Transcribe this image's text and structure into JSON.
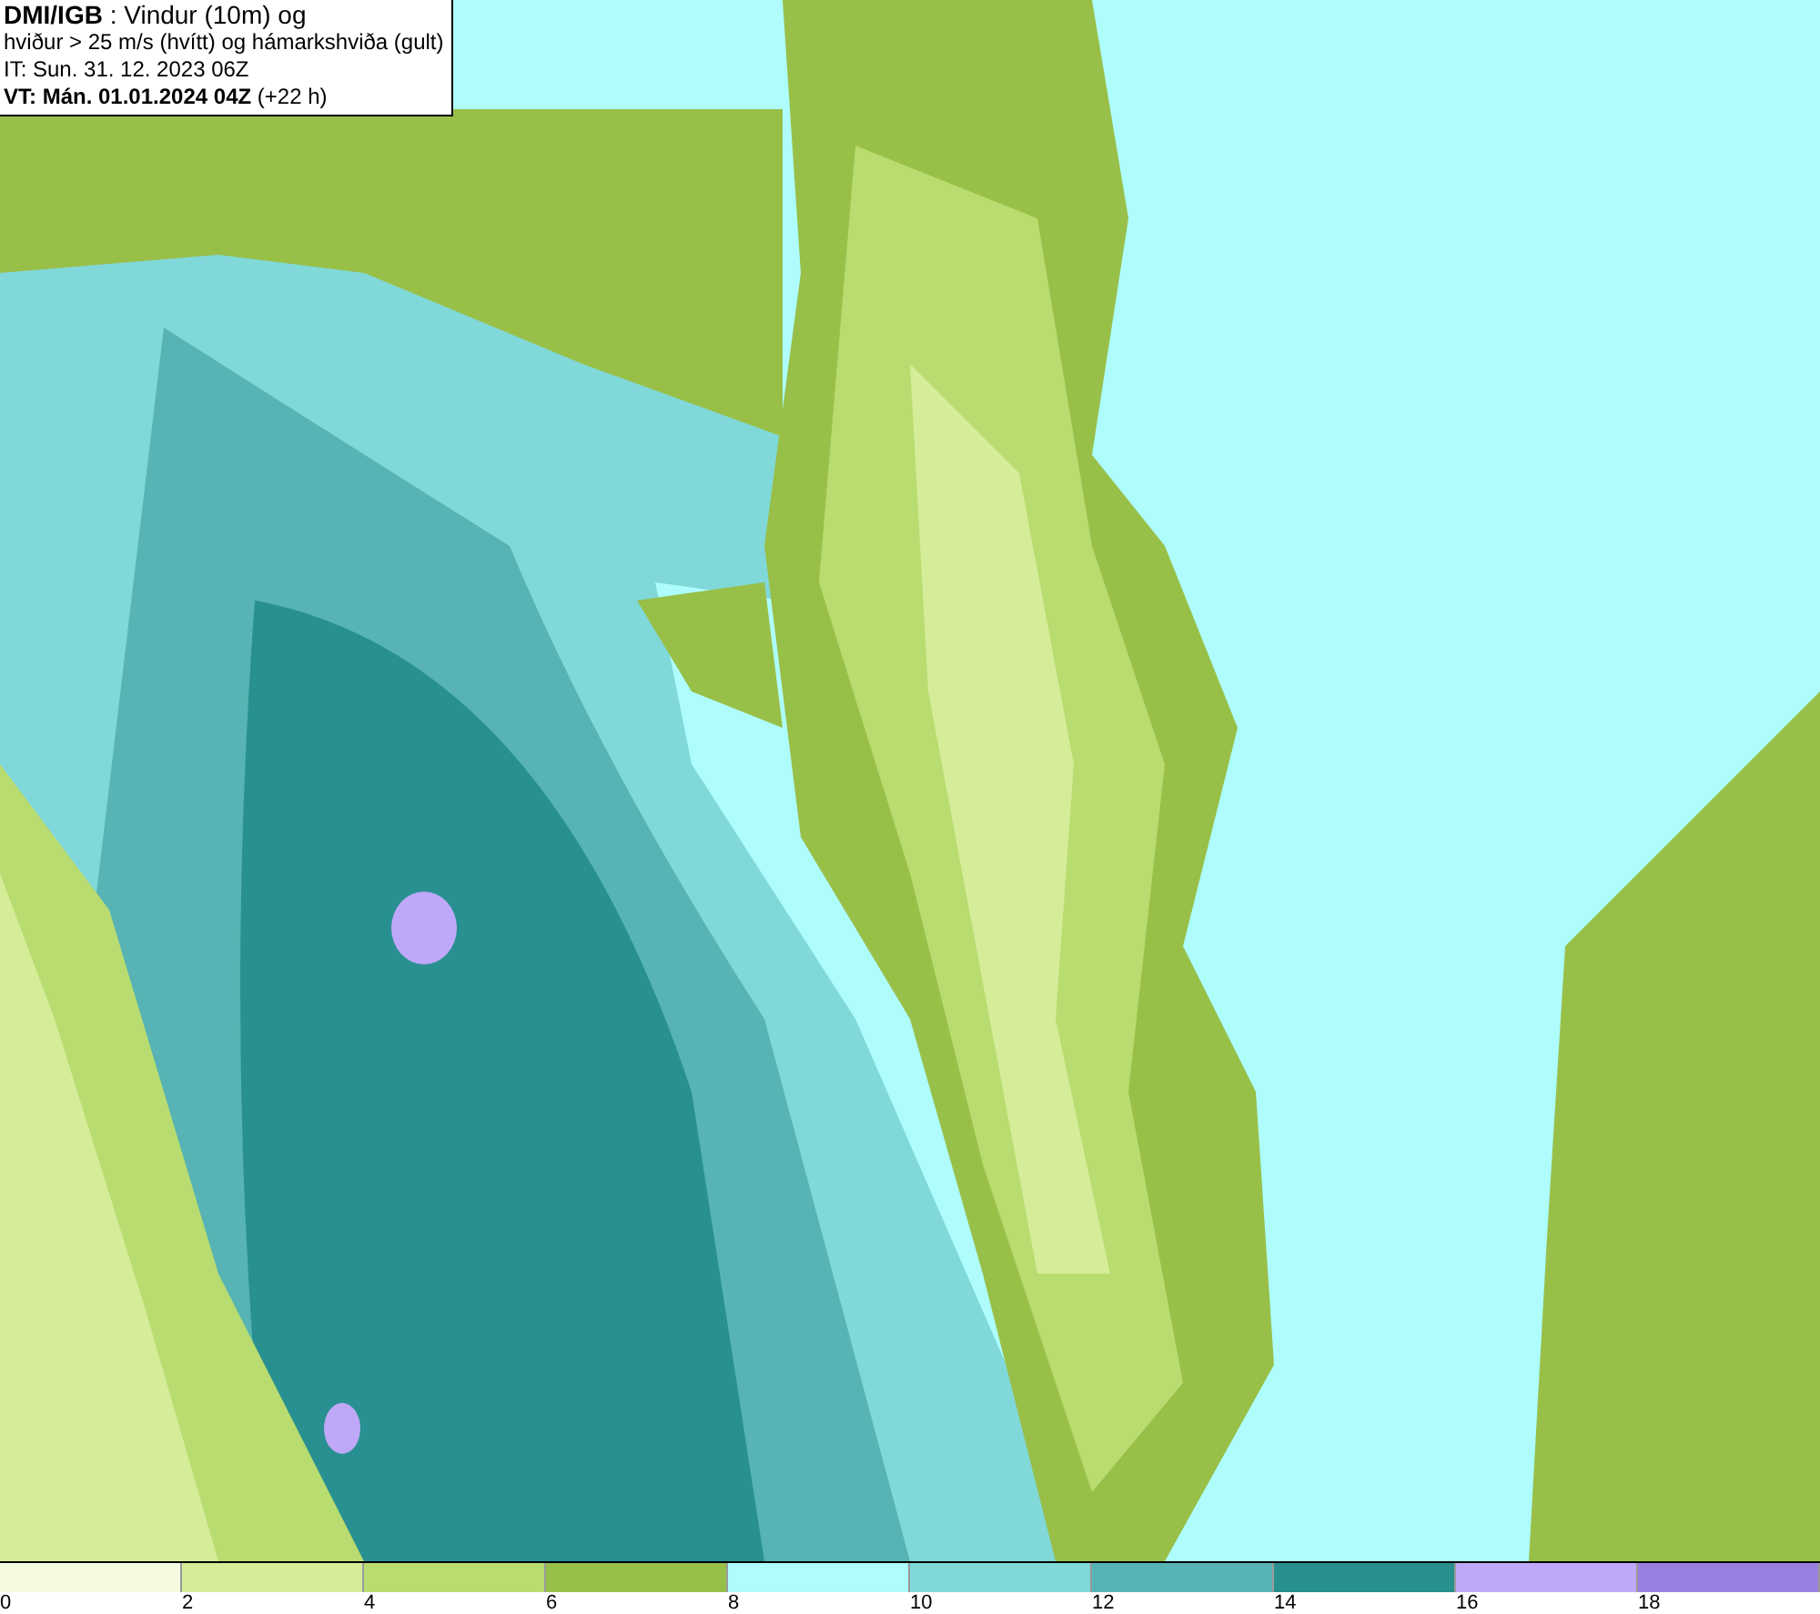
{
  "title_box": {
    "lines": [
      "**DMI/IGB** : Vindur (10m) og",
      "hviður > 25 m/s (hvítt) og hámarkshviða (gult)",
      "IT: Sun. 31. 12. 2023 06Z",
      "**VT: Mán. 01.01.2024 04Z** (+22 h)"
    ]
  },
  "legend": [
    {
      "label": "0",
      "color": "#f5fbe0"
    },
    {
      "label": "2",
      "color": "#d5ec98"
    },
    {
      "label": "4",
      "color": "#b8dc70"
    },
    {
      "label": "6",
      "color": "#98bf48"
    },
    {
      "label": "8",
      "color": "#aefcfc"
    },
    {
      "label": "10",
      "color": "#80d8d8"
    },
    {
      "label": "12",
      "color": "#58b4b4"
    },
    {
      "label": "14",
      "color": "#289090"
    },
    {
      "label": "16",
      "color": "#c0a8f8"
    },
    {
      "label": "18",
      "color": "#9880e0"
    }
  ]
}
